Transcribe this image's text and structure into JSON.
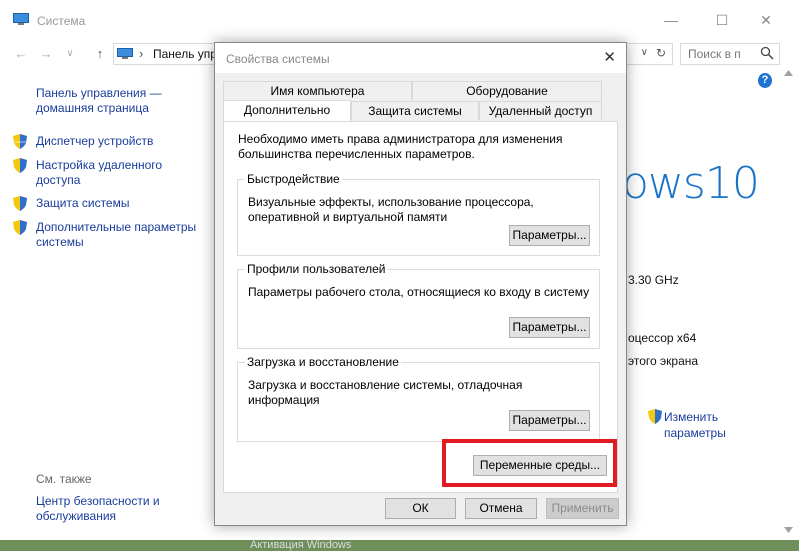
{
  "background_window": {
    "title": "Система",
    "minimize_glyph": "—",
    "maximize_glyph": "☐",
    "close_glyph": "✕",
    "address": {
      "back_glyph": "←",
      "forward_glyph": "→",
      "dropdown_glyph": "∨",
      "up_glyph": "↑",
      "separator": "›",
      "crumb": "Панель упр",
      "address_dropdown": "∨",
      "refresh_glyph": "↻"
    },
    "search_placeholder": "Поиск в п",
    "sidebar": {
      "home_link": "Панель управления — домашняя страница",
      "items": [
        {
          "label": "Диспетчер устройств"
        },
        {
          "label": "Настройка удаленного доступа"
        },
        {
          "label": "Защита системы"
        },
        {
          "label": "Дополнительные параметры системы"
        }
      ],
      "see_also": "См. также",
      "see_also_link": "Центр безопасности и обслуживания"
    },
    "help": "?",
    "windows_brand": "ows10",
    "right_texts": {
      "cpu_speed": "3.30 GHz",
      "processor": "оцессор x64",
      "screen": "этого экрана"
    },
    "change_link_line1": "Изменить",
    "change_link_line2": "параметры",
    "bottom_text": "Активация Windows"
  },
  "dialog": {
    "title": "Свойства системы",
    "close_glyph": "✕",
    "tabs_row1": [
      {
        "label": "Имя компьютера"
      },
      {
        "label": "Оборудование"
      }
    ],
    "tabs_row2": [
      {
        "label": "Дополнительно"
      },
      {
        "label": "Защита системы"
      },
      {
        "label": "Удаленный доступ"
      }
    ],
    "admin_note": "Необходимо иметь права администратора для изменения большинства перечисленных параметров.",
    "groups": {
      "performance": {
        "title": "Быстродействие",
        "description": "Визуальные эффекты, использование процессора, оперативной и виртуальной памяти",
        "button": "Параметры..."
      },
      "profiles": {
        "title": "Профили пользователей",
        "description": "Параметры рабочего стола, относящиеся ко входу в систему",
        "button": "Параметры..."
      },
      "startup": {
        "title": "Загрузка и восстановление",
        "description": "Загрузка и восстановление системы, отладочная информация",
        "button": "Параметры..."
      }
    },
    "env_button": "Переменные среды...",
    "ok_button": "ОК",
    "cancel_button": "Отмена",
    "apply_button": "Применить"
  },
  "colors": {
    "highlight": "#e01b24",
    "link": "#1a3d9c",
    "brand": "#1a75c8"
  }
}
